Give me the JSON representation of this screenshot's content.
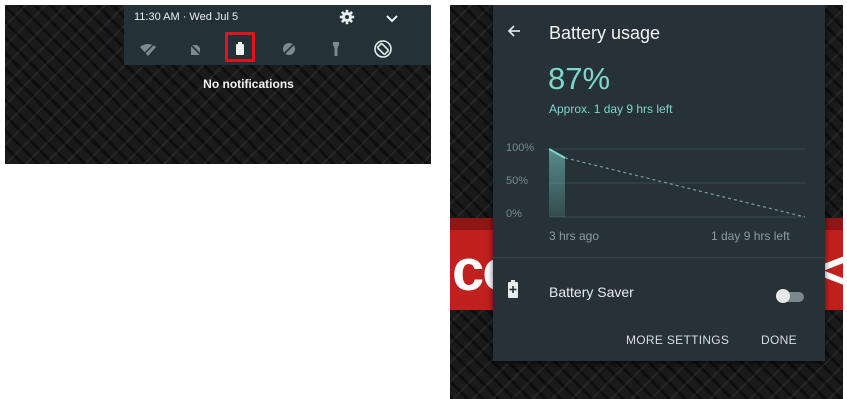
{
  "quick_settings": {
    "time_date": "11:30 AM · Wed Jul 5",
    "tiles": [
      {
        "name": "wifi-icon"
      },
      {
        "name": "notifications-off-icon"
      },
      {
        "name": "battery-icon",
        "highlighted": true
      },
      {
        "name": "do-not-disturb-icon"
      },
      {
        "name": "flashlight-icon"
      },
      {
        "name": "auto-rotate-icon"
      }
    ],
    "notifications_empty_text": "No notifications",
    "highlight_color": "#e0121b"
  },
  "battery_dialog": {
    "title": "Battery usage",
    "percent": "87%",
    "estimate": "Approx. 1 day 9 hrs left",
    "accent_color": "#7fd6cc",
    "battery_saver_label": "Battery Saver",
    "battery_saver_on": false,
    "more_settings_label": "MORE SETTINGS",
    "done_label": "DONE"
  },
  "chart_data": {
    "type": "line",
    "y_tick_labels": [
      "100%",
      "50%",
      "0%"
    ],
    "x_tick_labels": [
      "3 hrs ago",
      "1 day 9 hrs left"
    ],
    "ylim": [
      0,
      100
    ],
    "grid": true,
    "series": [
      {
        "values": [
          100,
          87
        ],
        "style": "solid"
      },
      {
        "values": [
          87,
          0
        ],
        "style": "dashed"
      }
    ]
  }
}
